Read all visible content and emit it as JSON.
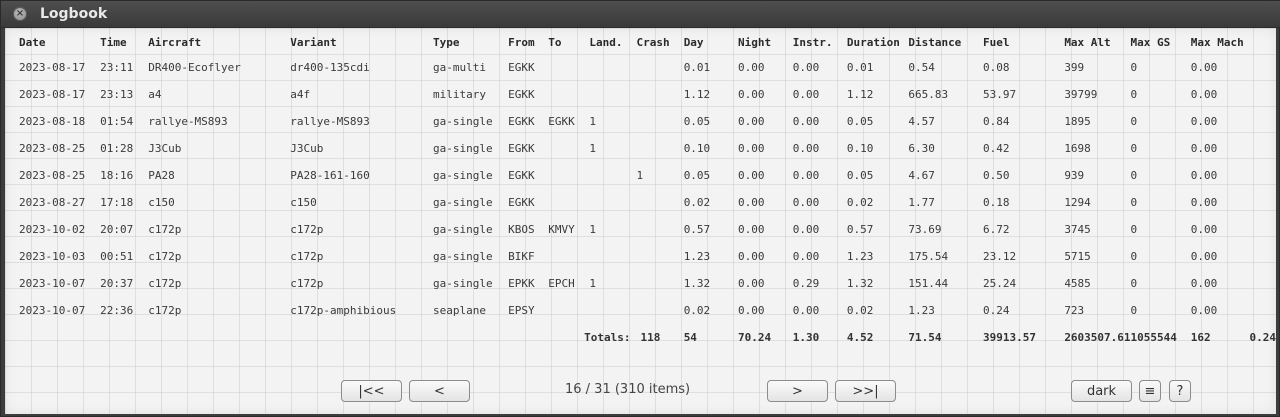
{
  "window": {
    "title": "Logbook",
    "close_icon": "×"
  },
  "table": {
    "columns": [
      "Date",
      "Time",
      "Aircraft",
      "Variant",
      "Type",
      "From",
      "To",
      "Land.",
      "Crash",
      "Day",
      "Night",
      "Instr.",
      "Duration",
      "Distance",
      "Fuel",
      "Max Alt",
      "Max GS",
      "Max Mach"
    ],
    "rows": [
      [
        "2023-08-17",
        "23:11",
        "DR400-Ecoflyer",
        "dr400-135cdi",
        "ga-multi",
        "EGKK",
        "",
        "",
        "",
        "0.01",
        "0.00",
        "0.00",
        "0.01",
        "0.54",
        "0.08",
        "399",
        "0",
        "0.00"
      ],
      [
        "2023-08-17",
        "23:13",
        "a4",
        "a4f",
        "military",
        "EGKK",
        "",
        "",
        "",
        "1.12",
        "0.00",
        "0.00",
        "1.12",
        "665.83",
        "53.97",
        "39799",
        "0",
        "0.00"
      ],
      [
        "2023-08-18",
        "01:54",
        "rallye-MS893",
        "rallye-MS893",
        "ga-single",
        "EGKK",
        "EGKK",
        "1",
        "",
        "0.05",
        "0.00",
        "0.00",
        "0.05",
        "4.57",
        "0.84",
        "1895",
        "0",
        "0.00"
      ],
      [
        "2023-08-25",
        "01:28",
        "J3Cub",
        "J3Cub",
        "ga-single",
        "EGKK",
        "",
        "1",
        "",
        "0.10",
        "0.00",
        "0.00",
        "0.10",
        "6.30",
        "0.42",
        "1698",
        "0",
        "0.00"
      ],
      [
        "2023-08-25",
        "18:16",
        "PA28",
        "PA28-161-160",
        "ga-single",
        "EGKK",
        "",
        "",
        "1",
        "0.05",
        "0.00",
        "0.00",
        "0.05",
        "4.67",
        "0.50",
        "939",
        "0",
        "0.00"
      ],
      [
        "2023-08-27",
        "17:18",
        "c150",
        "c150",
        "ga-single",
        "EGKK",
        "",
        "",
        "",
        "0.02",
        "0.00",
        "0.00",
        "0.02",
        "1.77",
        "0.18",
        "1294",
        "0",
        "0.00"
      ],
      [
        "2023-10-02",
        "20:07",
        "c172p",
        "c172p",
        "ga-single",
        "KBOS",
        "KMVY",
        "1",
        "",
        "0.57",
        "0.00",
        "0.00",
        "0.57",
        "73.69",
        "6.72",
        "3745",
        "0",
        "0.00"
      ],
      [
        "2023-10-03",
        "00:51",
        "c172p",
        "c172p",
        "ga-single",
        "BIKF",
        "",
        "",
        "",
        "1.23",
        "0.00",
        "0.00",
        "1.23",
        "175.54",
        "23.12",
        "5715",
        "0",
        "0.00"
      ],
      [
        "2023-10-07",
        "20:37",
        "c172p",
        "c172p",
        "ga-single",
        "EPKK",
        "EPCH",
        "1",
        "",
        "1.32",
        "0.00",
        "0.29",
        "1.32",
        "151.44",
        "25.24",
        "4585",
        "0",
        "0.00"
      ],
      [
        "2023-10-07",
        "22:36",
        "c172p",
        "c172p-amphibious",
        "seaplane",
        "EPSY",
        "",
        "",
        "",
        "0.02",
        "0.00",
        "0.00",
        "0.02",
        "1.23",
        "0.24",
        "723",
        "0",
        "0.00"
      ]
    ],
    "totals": {
      "label": "Totals:",
      "landings": "118",
      "crashes": "54",
      "day": "70.24",
      "night": "1.30",
      "instr": "4.52",
      "duration": "71.54",
      "distance": "39913.57",
      "fuel": "2603507.61",
      "max_alt": "1055544",
      "max_gs": "162",
      "max_mach": "0.24"
    }
  },
  "pager": {
    "first_label": "|<<",
    "prev_label": "<",
    "page_info": "16 / 31 (310 items)",
    "next_label": ">",
    "last_label": ">>|",
    "theme_label": "dark",
    "menu_label": "≡",
    "help_label": "?"
  }
}
